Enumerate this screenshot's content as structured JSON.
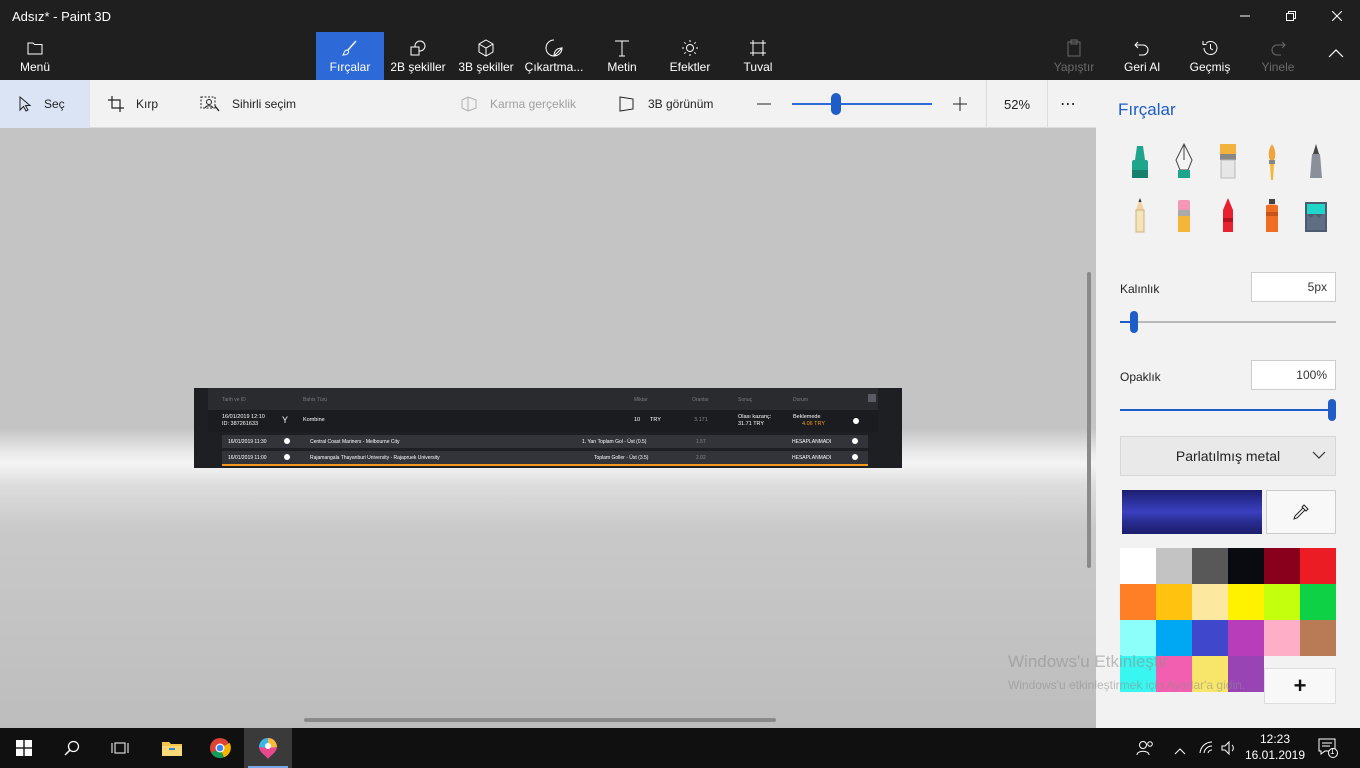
{
  "window": {
    "title": "Adsız* - Paint 3D"
  },
  "ribbon": {
    "menu": "Menü",
    "tabs": [
      {
        "label": "Fırçalar",
        "icon": "brush-icon"
      },
      {
        "label": "2B şekiller",
        "icon": "2d-shapes-icon"
      },
      {
        "label": "3B şekiller",
        "icon": "3d-cube-icon"
      },
      {
        "label": "Çıkartma...",
        "icon": "sticker-icon"
      },
      {
        "label": "Metin",
        "icon": "text-icon"
      },
      {
        "label": "Efektler",
        "icon": "effects-sun-icon"
      },
      {
        "label": "Tuval",
        "icon": "canvas-icon"
      }
    ],
    "actions": [
      {
        "label": "Yapıştır",
        "icon": "paste-icon"
      },
      {
        "label": "Geri Al",
        "icon": "undo-icon"
      },
      {
        "label": "Geçmiş",
        "icon": "history-icon"
      },
      {
        "label": "Yinele",
        "icon": "redo-icon"
      }
    ]
  },
  "toolbar": {
    "select": "Seç",
    "crop": "Kırp",
    "magic_select": "Sihirli seçim",
    "mixed_reality": "Karma gerçeklik",
    "view_3d": "3B görünüm",
    "zoom": "52%",
    "zoom_fraction": 0.3
  },
  "panel": {
    "title": "Fırçalar",
    "thickness_label": "Kalınlık",
    "thickness_value": "5px",
    "thickness_fraction": 0.05,
    "opacity_label": "Opaklık",
    "opacity_value": "100%",
    "opacity_fraction": 1.0,
    "material": "Parlatılmış metal",
    "swatches": [
      "#ffffff",
      "#c3c3c3",
      "#585858",
      "#0a0b10",
      "#88001b",
      "#ec1c24",
      "#ff7f27",
      "#ffc20e",
      "#fde8a0",
      "#fff200",
      "#c4ff0e",
      "#0ed145",
      "#8cfffb",
      "#00a8f3",
      "#3f48cc",
      "#b83dba",
      "#ffaec8",
      "#b97a56",
      "#39f7f0",
      "#f35fb0",
      "#f8e66a",
      "#9844b5"
    ]
  },
  "canvas_image": {
    "headers": [
      "Tarih ve ID",
      "Bahis Türü",
      "Miktar",
      "Oranlar",
      "Sonuç",
      "Durum"
    ],
    "main_row": {
      "date": "16/01/2019 12:10",
      "id": "ID: 387261633",
      "type": "Kombine",
      "amount": "10",
      "currency": "TRY",
      "odds": "3.171",
      "possible_label": "Olası kazanç:",
      "possible_value": "31.71 TRY",
      "status": "Beklemede",
      "status_value": "4.06 TRY"
    },
    "sub_rows": [
      {
        "date": "16/01/2019 11:30",
        "match": "Central Coast Mariners - Melbourne City",
        "market": "1. Yarı Toplam Gol - Üst (0.5)",
        "odds": "1.57",
        "status": "HESAPLANMADI"
      },
      {
        "date": "16/01/2019 11:00",
        "match": "Rajamangala Thayanburi University - Rajapruek University",
        "market": "Toplam Goller - Üst (3.5)",
        "odds": "2.02",
        "status": "HESAPLANMADI"
      }
    ]
  },
  "watermark": {
    "line1": "Windows'u Etkinleştir",
    "line2": "Windows'u etkinleştirmek için Ayarlar'a gidin."
  },
  "taskbar": {
    "time": "12:23",
    "date": "16.01.2019",
    "notifications": "1"
  }
}
